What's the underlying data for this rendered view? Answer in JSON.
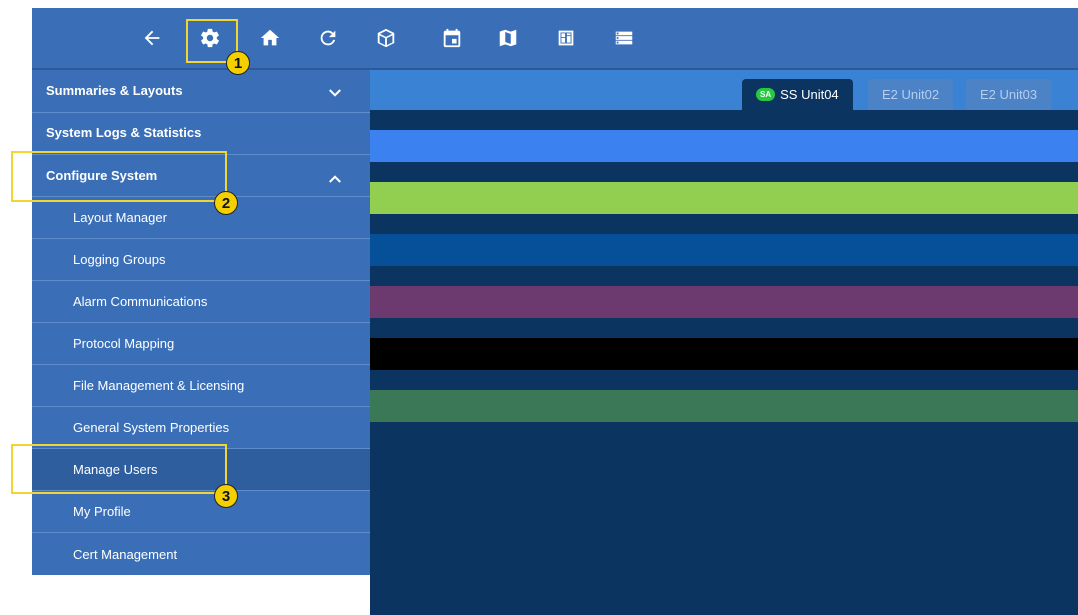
{
  "toolbar": {
    "icons": [
      "back-arrow-icon",
      "gear-icon",
      "home-icon",
      "refresh-icon",
      "box-icon",
      "calendar-icon",
      "map-icon",
      "dashboard-icon",
      "list-icon"
    ]
  },
  "sidebar": {
    "sections": [
      {
        "label": "Summaries & Layouts",
        "chevron": "down"
      },
      {
        "label": "System Logs & Statistics"
      },
      {
        "label": "Configure System",
        "chevron": "up"
      }
    ],
    "items": [
      {
        "label": "Layout Manager"
      },
      {
        "label": "Logging Groups"
      },
      {
        "label": "Alarm Communications"
      },
      {
        "label": "Protocol Mapping"
      },
      {
        "label": "File Management & Licensing"
      },
      {
        "label": "General System Properties"
      },
      {
        "label": "Manage Users",
        "selected": true
      },
      {
        "label": "My Profile"
      },
      {
        "label": "Cert Management"
      }
    ]
  },
  "tabs": [
    {
      "label": "SS Unit04",
      "badge": "SA",
      "active": true
    },
    {
      "label": "E2 Unit02",
      "active": false
    },
    {
      "label": "E2 Unit03",
      "active": false
    }
  ],
  "bands": {
    "colors": [
      "#3b82f0",
      "#92cf50",
      "#064f99",
      "#6d3a6f",
      "#000000",
      "#3b7857"
    ]
  },
  "annotations": [
    "1",
    "2",
    "3"
  ],
  "colors": {
    "toolbar": "#3a6fb8",
    "sidebar": "#3a6fb8",
    "main_bg": "#0b3461",
    "highlight": "#f2d433",
    "badge": "#27c93f"
  }
}
